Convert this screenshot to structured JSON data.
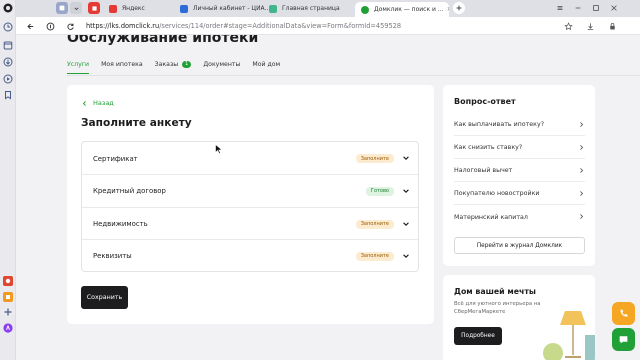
{
  "tabs": [
    {
      "label": "Яндекс",
      "fav": "#e53935"
    },
    {
      "label": "Личный кабинет - ЦИА…",
      "fav": "#2c6bd9"
    },
    {
      "label": "Главная страница",
      "fav": "#43b58d"
    },
    {
      "label": "Домклик — поиск и …",
      "fav": "#21a038"
    }
  ],
  "address": {
    "host": "https://lks.domclick.ru",
    "path": "/services/114/order#stage=AdditionalData&view=Form&formId=459528"
  },
  "page": {
    "title": "Обслуживание ипотеки",
    "subnav": [
      {
        "label": "Услуги",
        "active": true
      },
      {
        "label": "Моя ипотека"
      },
      {
        "label": "Заказы",
        "badge": "1"
      },
      {
        "label": "Документы"
      },
      {
        "label": "Мой дом"
      }
    ]
  },
  "form": {
    "back_label": "Назад",
    "title": "Заполните анкету",
    "sections": [
      {
        "label": "Сертификат",
        "status": "Заполните",
        "kind": "warn"
      },
      {
        "label": "Кредитный договор",
        "status": "Готово",
        "kind": "ok"
      },
      {
        "label": "Недвижимость",
        "status": "Заполните",
        "kind": "warn"
      },
      {
        "label": "Реквизиты",
        "status": "Заполните",
        "kind": "warn"
      }
    ],
    "save_label": "Сохранить"
  },
  "faq": {
    "title": "Вопрос-ответ",
    "items": [
      "Как выплачивать ипотеку?",
      "Как снизить ставку?",
      "Налоговый вычет",
      "Покупателю новостройки",
      "Материнский капитал"
    ],
    "journal_label": "Перейти в журнал Домклик"
  },
  "promo": {
    "title": "Дом вашей мечты",
    "text": "Всё для уютного интерьера на СберМегаМаркете",
    "button_label": "Подробнее"
  },
  "colors": {
    "accent": "#21a038",
    "warn_bg": "#fdebd0",
    "ok_bg": "#ddf3df",
    "float_phone": "#f5a623",
    "float_chat": "#21a038"
  },
  "icons": [
    "clock-icon",
    "calendar-icon",
    "download-icon",
    "play-icon",
    "bookmark-icon",
    "add-icon"
  ]
}
